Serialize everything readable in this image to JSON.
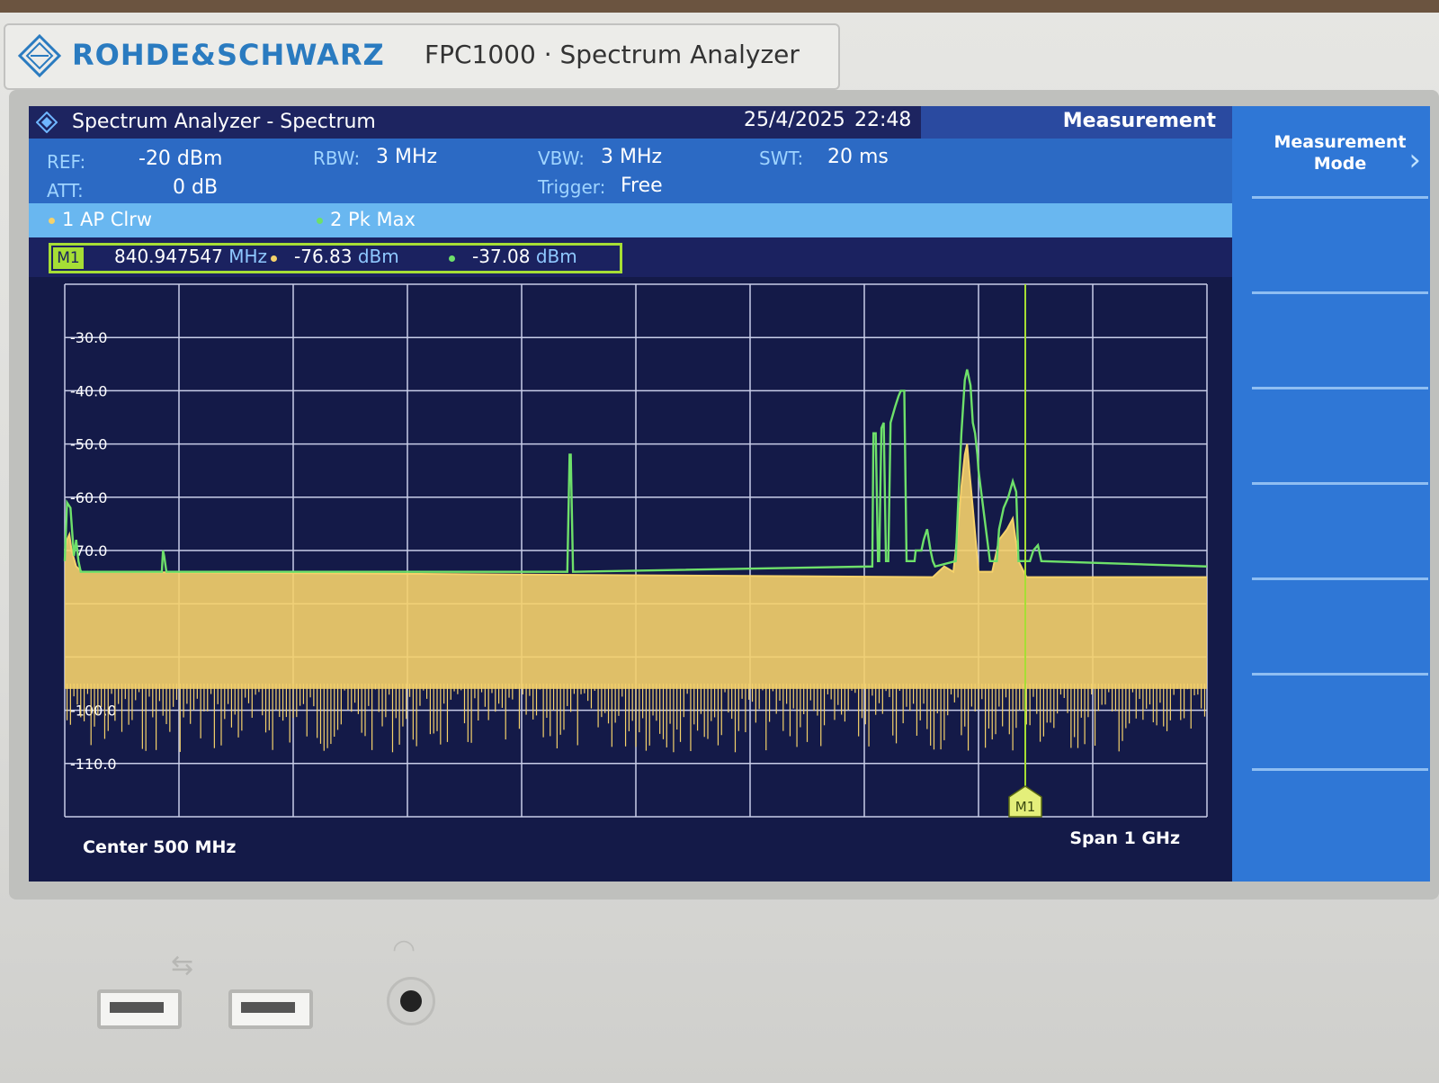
{
  "device": {
    "brand": "ROHDE&SCHWARZ",
    "model": "FPC1000 · Spectrum Analyzer"
  },
  "titlebar": {
    "title": "Spectrum Analyzer - Spectrum",
    "date": "25/4/2025",
    "time": "22:48",
    "menu": "Measurement"
  },
  "params": {
    "ref_label": "REF:",
    "ref": "-20 dBm",
    "att_label": "ATT:",
    "att": "0 dB",
    "rbw_label": "RBW:",
    "rbw": "3 MHz",
    "vbw_label": "VBW:",
    "vbw": "3 MHz",
    "trigger_label": "Trigger:",
    "trigger": "Free",
    "swt_label": "SWT:",
    "swt": "20 ms"
  },
  "traces": [
    {
      "label": "1 AP  Clrw",
      "color": "#f5d26b"
    },
    {
      "label": "2 Pk  Max",
      "color": "#6ee06a"
    }
  ],
  "marker": {
    "tag": "M1",
    "freq": "840.947547",
    "freq_unit": "MHz",
    "val1": "-76.83",
    "val1_unit": "dBm",
    "val2": "-37.08",
    "val2_unit": "dBm"
  },
  "softkeys": {
    "measurement_mode": "Measurement Mode"
  },
  "chart_data": {
    "type": "line",
    "xlabel_left": "Center 500 MHz",
    "xlabel_right": "Span 1 GHz",
    "x_range_mhz": [
      0,
      1000
    ],
    "ylim": [
      -120,
      -20
    ],
    "ytick_labels": [
      "-30.0",
      "-40.0",
      "-50.0",
      "-60.0",
      "-70.0",
      "-100.0",
      "-110.0"
    ],
    "yticks": [
      -30,
      -40,
      -50,
      -60,
      -70,
      -100,
      -110
    ],
    "grid": true,
    "marker": {
      "label": "M1",
      "x_mhz": 840.947547
    },
    "series": [
      {
        "name": "2 Pk Max",
        "color": "#6ee06a",
        "points": [
          [
            0,
            -72
          ],
          [
            2,
            -61
          ],
          [
            5,
            -62
          ],
          [
            8,
            -71
          ],
          [
            10,
            -68
          ],
          [
            12,
            -72
          ],
          [
            14,
            -74
          ],
          [
            85,
            -74
          ],
          [
            86,
            -70
          ],
          [
            87,
            -71
          ],
          [
            89,
            -74
          ],
          [
            440,
            -74
          ],
          [
            442,
            -52
          ],
          [
            443,
            -52
          ],
          [
            445,
            -74
          ],
          [
            707,
            -73
          ],
          [
            708,
            -48
          ],
          [
            710,
            -48
          ],
          [
            712,
            -72
          ],
          [
            713,
            -72
          ],
          [
            715,
            -47
          ],
          [
            717,
            -46
          ],
          [
            719,
            -72
          ],
          [
            721,
            -72
          ],
          [
            723,
            -46
          ],
          [
            727,
            -43
          ],
          [
            730,
            -41
          ],
          [
            732,
            -40
          ],
          [
            735,
            -40
          ],
          [
            737,
            -72
          ],
          [
            742,
            -72
          ],
          [
            744,
            -72
          ],
          [
            745,
            -70
          ],
          [
            750,
            -70
          ],
          [
            752,
            -68
          ],
          [
            755,
            -66
          ],
          [
            758,
            -70
          ],
          [
            760,
            -72
          ],
          [
            762,
            -73
          ],
          [
            780,
            -72
          ],
          [
            782,
            -62
          ],
          [
            785,
            -48
          ],
          [
            788,
            -38
          ],
          [
            790,
            -36
          ],
          [
            793,
            -39
          ],
          [
            795,
            -46
          ],
          [
            797,
            -48
          ],
          [
            799,
            -52
          ],
          [
            800,
            -55
          ],
          [
            810,
            -72
          ],
          [
            816,
            -72
          ],
          [
            818,
            -66
          ],
          [
            822,
            -62
          ],
          [
            826,
            -60
          ],
          [
            830,
            -57
          ],
          [
            833,
            -59
          ],
          [
            835,
            -72
          ],
          [
            845,
            -72
          ],
          [
            848,
            -70
          ],
          [
            852,
            -69
          ],
          [
            855,
            -72
          ],
          [
            1000,
            -73
          ]
        ]
      },
      {
        "name": "1 AP Clrw",
        "color": "#f5d26b",
        "points": [
          [
            0,
            -70
          ],
          [
            2,
            -68
          ],
          [
            4,
            -67
          ],
          [
            6,
            -70
          ],
          [
            10,
            -73
          ],
          [
            15,
            -74
          ],
          [
            760,
            -75
          ],
          [
            770,
            -73
          ],
          [
            778,
            -74
          ],
          [
            782,
            -66
          ],
          [
            785,
            -58
          ],
          [
            788,
            -52
          ],
          [
            790,
            -50
          ],
          [
            792,
            -55
          ],
          [
            795,
            -62
          ],
          [
            800,
            -74
          ],
          [
            812,
            -74
          ],
          [
            818,
            -68
          ],
          [
            825,
            -66
          ],
          [
            830,
            -64
          ],
          [
            835,
            -72
          ],
          [
            842,
            -75
          ],
          [
            1000,
            -75
          ]
        ]
      }
    ]
  }
}
